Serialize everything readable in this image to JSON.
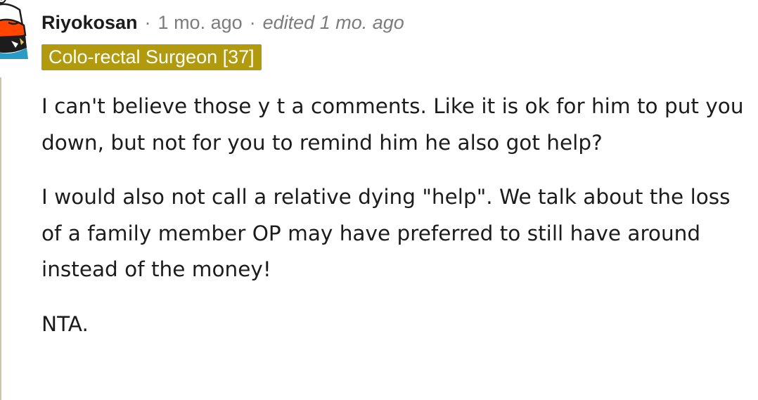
{
  "comment": {
    "author": "Riyokosan",
    "separator": "·",
    "timestamp": "1 mo. ago",
    "edited": "edited 1 mo. ago",
    "flair": "Colo-rectal Surgeon [37]",
    "paragraphs": [
      "I can't believe those y t a comments. Like it is ok for him to put you down, but not for you to remind him he also got help?",
      "I would also not call a relative dying \"help\". We talk about the loss of a family member OP may have preferred to still have around instead of the money!",
      "NTA."
    ]
  },
  "icons": {
    "avatar": "snoo-avatar-icon"
  },
  "colors": {
    "flair_background": "#b19a0d",
    "flair_text": "#ffffff",
    "text": "#1c1c1c",
    "meta_text": "#7c7c7c",
    "avatar_orange": "#ff4500",
    "avatar_teal": "#2a9bc4"
  }
}
